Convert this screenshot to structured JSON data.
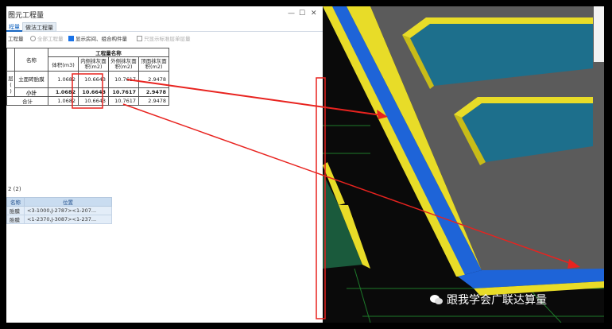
{
  "window": {
    "title": "图元工程量",
    "controls": [
      "—",
      "☐",
      "✕"
    ]
  },
  "tabs": [
    {
      "label": "程量",
      "active": true
    },
    {
      "label": "做法工程量",
      "active": false
    }
  ],
  "options": {
    "item1": "工程量",
    "item2": "全部工程量",
    "item3": "显示房间、组合构件量",
    "item4": "只显示标准层单层量"
  },
  "table": {
    "group_header": "工程量名称",
    "name_header": "名称",
    "col_volume": "体积(m3)",
    "col_inner": "内侧抹灰面积(m2)",
    "col_outer": "外侧抹灰面积(m2)",
    "col_top": "顶面抹灰面积(m2)",
    "row1_prefix": "层(\n)",
    "row1_name": "立面砖胎膜",
    "row1_volume": "1.0682",
    "row1_inner": "10.6643",
    "row1_outer": "10.7617",
    "row1_top": "2.9478",
    "row2_name": "小计",
    "row2_volume": "1.0682",
    "row2_inner": "10.6643",
    "row2_outer": "10.7617",
    "row2_top": "2.9478",
    "row3_name": "合计",
    "row3_volume": "1.0682",
    "row3_inner": "10.6643",
    "row3_outer": "10.7617",
    "row3_top": "2.9478"
  },
  "bottom": {
    "count_label": "2 (2)",
    "col_name": "名称",
    "col_position": "位置",
    "rows": [
      {
        "name": "胎膜",
        "position": "<3-1000,J-2787><1-207..."
      },
      {
        "name": "胎膜",
        "position": "<1-2370,J-3087><1-237..."
      }
    ]
  },
  "watermark": "跟我学会广联达算量",
  "colors": {
    "highlight": "#e8231f",
    "wall_blue": "#1e64d8",
    "wall_yellow": "#f0e020",
    "slab_grey": "#5a5a5a",
    "pool_teal": "#1d6f8c"
  }
}
